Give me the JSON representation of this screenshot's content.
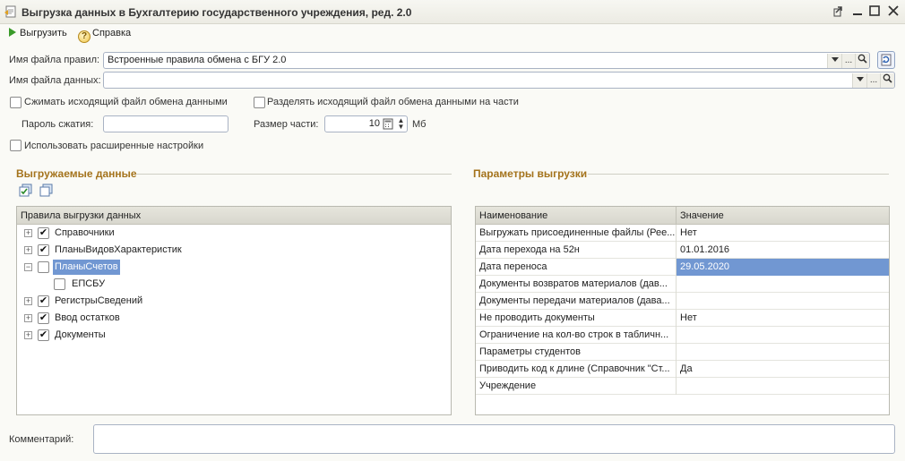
{
  "window": {
    "title": "Выгрузка данных в Бухгалтерию государственного учреждения, ред. 2.0",
    "controls": [
      "link-icon",
      "minimize-icon",
      "maximize-icon",
      "close-icon"
    ]
  },
  "toolbar": {
    "export_label": "Выгрузить",
    "help_label": "Справка",
    "help_glyph": "?"
  },
  "form": {
    "rules_file_label": "Имя файла правил:",
    "rules_file_value": "Встроенные правила обмена с БГУ 2.0",
    "data_file_label": "Имя файла данных:",
    "data_file_value": "",
    "ellipsis": "...",
    "compress_label": "Сжимать исходящий файл обмена данными",
    "compress_checked": false,
    "split_label": "Разделять исходящий файл обмена данными на части",
    "split_checked": false,
    "password_label": "Пароль сжатия:",
    "password_value": "",
    "part_size_label": "Размер части:",
    "part_size_value": "10",
    "part_size_unit": "Мб",
    "advanced_label": "Использовать расширенные настройки",
    "advanced_checked": false,
    "comment_label": "Комментарий:",
    "comment_value": ""
  },
  "export_data": {
    "section_title": "Выгружаемые данные",
    "column_header": "Правила выгрузки данных",
    "tree": [
      {
        "label": "Справочники",
        "checked": true,
        "expander": "+"
      },
      {
        "label": "ПланыВидовХарактеристик",
        "checked": true,
        "expander": "+"
      },
      {
        "label": "ПланыСчетов",
        "checked": false,
        "expander": "−"
      },
      {
        "label": "ЕПСБУ",
        "checked": false
      },
      {
        "label": "РегистрыСведений",
        "checked": true,
        "expander": "+"
      },
      {
        "label": "Ввод остатков",
        "checked": true,
        "expander": "+"
      },
      {
        "label": "Документы",
        "checked": true,
        "expander": "+"
      }
    ]
  },
  "export_params": {
    "section_title": "Параметры выгрузки",
    "col_name": "Наименование",
    "col_value": "Значение",
    "rows": [
      {
        "name": "Выгружать присоединенные файлы (Рее...",
        "value": "Нет"
      },
      {
        "name": "Дата перехода на 52н",
        "value": "01.01.2016"
      },
      {
        "name": "Дата переноса",
        "value": "29.05.2020"
      },
      {
        "name": "Документы возвратов материалов (дав...",
        "value": ""
      },
      {
        "name": "Документы передачи материалов (дава...",
        "value": ""
      },
      {
        "name": "Не проводить документы",
        "value": "Нет"
      },
      {
        "name": "Ограничение на кол-во строк в табличн...",
        "value": ""
      },
      {
        "name": "Параметры студентов",
        "value": ""
      },
      {
        "name": "Приводить код к длине (Справочник \"Ст...",
        "value": "Да"
      },
      {
        "name": "Учреждение",
        "value": ""
      }
    ]
  },
  "colors": {
    "accent_title": "#a4731c",
    "selection": "#7197d2"
  }
}
